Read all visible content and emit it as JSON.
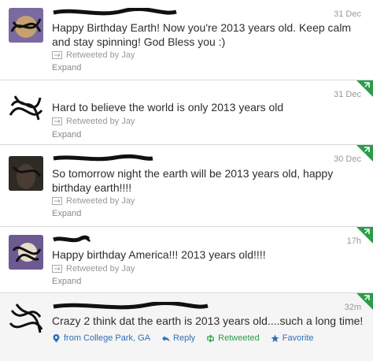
{
  "tweets": [
    {
      "time": "31 Dec",
      "text": "Happy Birthday Earth! Now you're 2013 years old. Keep calm and stay spinning! God Bless you :)",
      "retweeted_by": "Retweeted by Jay",
      "expand": "Expand"
    },
    {
      "time": "31 Dec",
      "text": "Hard to believe the world is only 2013 years old",
      "retweeted_by": "Retweeted by Jay",
      "expand": "Expand"
    },
    {
      "time": "30 Dec",
      "text": "So tomorrow night the earth will be 2013 years old, happy birthday earth!!!!",
      "retweeted_by": "Retweeted by Jay",
      "expand": "Expand"
    },
    {
      "time": "17h",
      "text": "Happy birthday America!!! 2013 years old!!!!",
      "retweeted_by": "Retweeted by Jay",
      "expand": "Expand"
    },
    {
      "time": "32m",
      "text": "Crazy 2 think dat the earth is 2013 years old....such a long time!",
      "location": "from College Park, GA",
      "reply": "Reply",
      "retweeted": "Retweeted",
      "favorite": "Favorite"
    }
  ],
  "colors": {
    "retweet_green": "#2c9c4a",
    "link_blue": "#2f6fb8",
    "meta_gray": "#999999"
  }
}
